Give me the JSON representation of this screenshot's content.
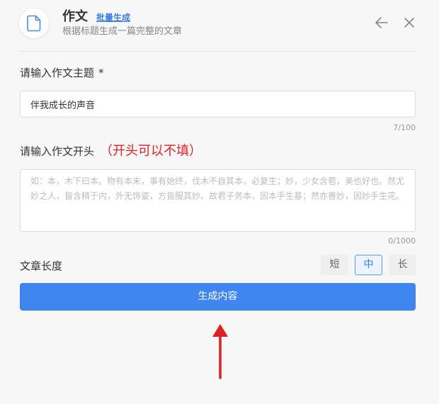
{
  "header": {
    "title": "作文",
    "batch_link": "批量生成",
    "subtitle": "根据标题生成一篇完整的文章"
  },
  "topic": {
    "label": "请输入作文主题",
    "required_mark": "*",
    "value": "伴我成长的声音",
    "counter": "7/100"
  },
  "opening": {
    "label": "请输入作文开头",
    "hint": "（开头可以不填）",
    "placeholder": "如：本，木下曰本。物有本末，事有始终，伐木不自其本，必复生；妙，少女含苞，美也好也。然尤妙之人，皆含精于内，外无饰姿，方皆服其妙。故君子务本，因本手生基；然亦善妙，因妙手生花。",
    "counter": "0/1000"
  },
  "length": {
    "label": "文章长度",
    "options": [
      "短",
      "中",
      "长"
    ],
    "selected": "中"
  },
  "generate_label": "生成内容",
  "colors": {
    "accent": "#3e85f0",
    "annotation_arrow": "#e02020"
  }
}
